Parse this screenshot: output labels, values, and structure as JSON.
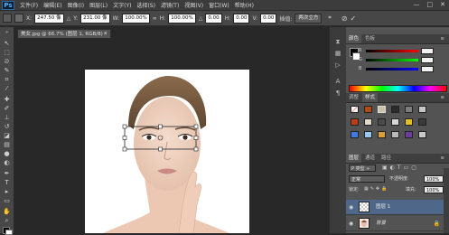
{
  "app": {
    "logo": "Ps"
  },
  "menu": [
    "文件(F)",
    "编辑(E)",
    "图像(I)",
    "图层(L)",
    "文字(Y)",
    "选择(S)",
    "滤镜(T)",
    "视图(V)",
    "窗口(W)",
    "帮助(H)"
  ],
  "window_controls": {
    "minimize": "—",
    "restore": "□",
    "close": "✕"
  },
  "options": {
    "x_label": "X:",
    "x_value": "247.50 像",
    "delta_label": "△",
    "y_label": "Y:",
    "y_value": "231.00 像",
    "w_label": "W:",
    "w_value": "100.00%",
    "h_label": "H:",
    "h_value": "100.00%",
    "angle_label": "△",
    "angle_value": "0.00",
    "hskew_label": "H:",
    "hskew_value": "0.00",
    "vskew_label": "V:",
    "vskew_value": "0.00",
    "interp_label": "插值:",
    "interp_value": "两次立方"
  },
  "document": {
    "tab_title": "美女.jpg @ 66.7% (图层 1, RGB/8) *",
    "close": "✕"
  },
  "panels": {
    "color_tab": "颜色",
    "swatches_tab": "色板",
    "adjust_tab": "调整",
    "styles_tab": "样式",
    "layers_tab": "图层",
    "channels_tab": "通道",
    "paths_tab": "路径",
    "kind_label": "P 类型 ÷",
    "blend_mode": "正常",
    "opacity_label": "不透明度:",
    "opacity_value": "100%",
    "lock_label": "锁定:",
    "fill_label": "填充:",
    "fill_value": "100%",
    "layers": [
      {
        "name": "图层 1",
        "selected": true
      },
      {
        "name": "背景",
        "selected": false
      }
    ]
  },
  "colors": {
    "foreground": "#000000",
    "background": "#ffffff",
    "selected_layer": "#4f6788",
    "panel_bg": "#535353"
  },
  "icons": [
    "move-icon",
    "marquee-icon",
    "lasso-icon",
    "quick-select-icon",
    "crop-icon",
    "eyedropper-icon",
    "healing-icon",
    "brush-icon",
    "stamp-icon",
    "history-brush-icon",
    "eraser-icon",
    "gradient-icon",
    "blur-icon",
    "dodge-icon",
    "pen-icon",
    "type-icon",
    "path-select-icon",
    "shape-icon",
    "hand-icon",
    "zoom-icon"
  ]
}
